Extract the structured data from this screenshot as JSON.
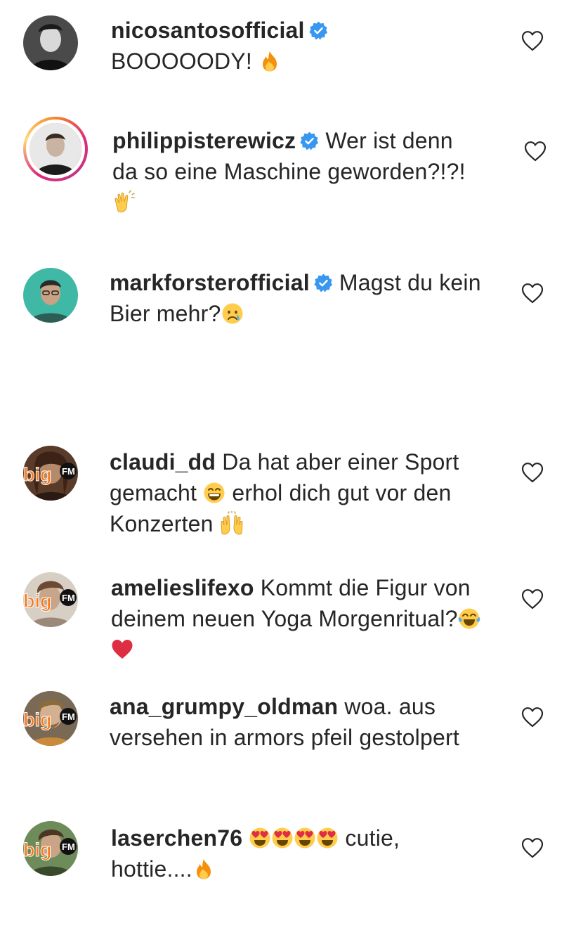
{
  "comments": [
    {
      "username": "nicosantosofficial",
      "verified": true,
      "text": "BOOOOODY!",
      "emoji": [
        "fire"
      ],
      "avatar_icon": "profile-photo"
    },
    {
      "username": "philippisterewicz",
      "verified": true,
      "text": "Wer ist denn da so eine Maschine geworden?!?!",
      "emoji": [
        "clapping-hands"
      ],
      "avatar_icon": "profile-photo-story-ring"
    },
    {
      "username": "markforsterofficial",
      "verified": true,
      "text": "Magst du kein Bier mehr?",
      "emoji": [
        "crying-face"
      ],
      "avatar_icon": "profile-photo"
    },
    {
      "username": "claudi_dd",
      "verified": false,
      "text_part1": "Da hat aber einer Sport gemacht",
      "text_part2": "erhol dich gut vor den Konzerten",
      "emoji": [
        "grinning-face",
        "raising-hands"
      ],
      "avatar_icon": "bigfm-photo"
    },
    {
      "username": "amelieslifexo",
      "verified": false,
      "text": "Kommt die Figur von deinem neuen Yoga Morgenritual?",
      "emoji": [
        "tears-of-joy",
        "red-heart"
      ],
      "avatar_icon": "bigfm-photo"
    },
    {
      "username": "ana_grumpy_oldman",
      "verified": false,
      "text": "woa. aus versehen in armors pfeil gestolpert",
      "emoji": [],
      "avatar_icon": "bigfm-photo"
    },
    {
      "username": "laserchen76",
      "verified": false,
      "text_part1": "cutie,",
      "text_part2": "hottie....",
      "emoji": [
        "heart-eyes",
        "heart-eyes",
        "heart-eyes",
        "heart-eyes",
        "fire"
      ],
      "avatar_icon": "bigfm-photo"
    }
  ],
  "bigfm_logo": {
    "big": "big",
    "fm": "FM"
  },
  "colors": {
    "text": "#262626",
    "verified": "#3897f0",
    "bigfm_orange": "#f47b20",
    "heart_outline": "#262626"
  },
  "icons": {
    "like": "heart-outline-icon",
    "verified": "verified-badge-icon"
  }
}
